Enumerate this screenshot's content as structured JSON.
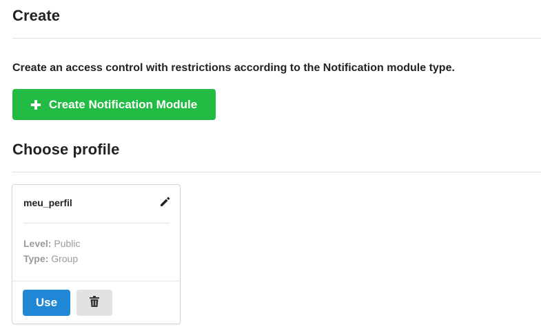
{
  "create_section": {
    "title": "Create",
    "description": "Create an access control with restrictions according to the Notification module type.",
    "create_button_label": "Create Notification Module",
    "create_button_icon": "plus-icon",
    "create_button_color": "#22bb44"
  },
  "profile_section": {
    "title": "Choose profile"
  },
  "profile_card": {
    "name": "meu_perfil",
    "edit_icon": "pencil-icon",
    "level_label": "Level:",
    "level_value": "Public",
    "type_label": "Type:",
    "type_value": "Group",
    "use_button_label": "Use",
    "use_button_color": "#1f87d6",
    "delete_icon": "trash-icon"
  }
}
